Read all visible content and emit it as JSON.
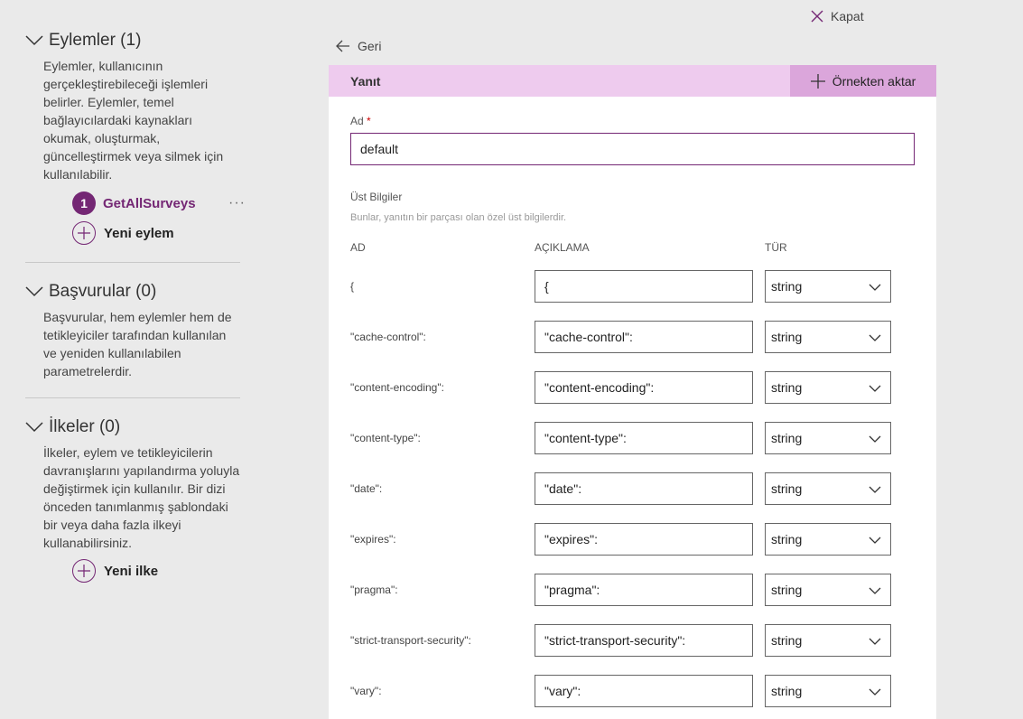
{
  "close": {
    "label": "Kapat",
    "icon": "close-icon"
  },
  "sidebar": {
    "actions": {
      "title": "Eylemler (1)",
      "description": "Eylemler, kullanıcının gerçekleştirebileceği işlemleri belirler. Eylemler, temel bağlayıcılardaki kaynakları okumak, oluşturmak, güncelleştirmek veya silmek için kullanılabilir.",
      "items": [
        {
          "number": "1",
          "name": "GetAllSurveys",
          "more": "···"
        }
      ],
      "new_label": "Yeni eylem"
    },
    "references": {
      "title": "Başvurular (0)",
      "description": "Başvurular, hem eylemler hem de tetikleyiciler tarafından kullanılan ve yeniden kullanılabilen parametrelerdir."
    },
    "policies": {
      "title": "İlkeler (0)",
      "description": "İlkeler, eylem ve tetikleyicilerin davranışlarını yapılandırma yoluyla değiştirmek için kullanılır. Bir dizi önceden tanımlanmış şablondaki bir veya daha fazla ilkeyi kullanabilirsiniz.",
      "new_label": "Yeni ilke"
    }
  },
  "back": {
    "label": "Geri"
  },
  "response": {
    "title": "Yanıt",
    "import_label": "Örnekten aktar",
    "name_label": "Ad",
    "required_mark": "*",
    "name_value": "default",
    "headers_title": "Üst Bilgiler",
    "headers_desc": "Bunlar, yanıtın bir parçası olan özel üst bilgilerdir.",
    "columns": {
      "name": "AD",
      "description": "AÇIKLAMA",
      "type": "TÜR"
    },
    "rows": [
      {
        "name": "{",
        "description": "{",
        "type": "string"
      },
      {
        "name": "\"cache-control\":",
        "description": "\"cache-control\":",
        "type": "string"
      },
      {
        "name": "\"content-encoding\":",
        "description": "\"content-encoding\":",
        "type": "string"
      },
      {
        "name": "\"content-type\":",
        "description": "\"content-type\":",
        "type": "string"
      },
      {
        "name": "\"date\":",
        "description": "\"date\":",
        "type": "string"
      },
      {
        "name": "\"expires\":",
        "description": "\"expires\":",
        "type": "string"
      },
      {
        "name": "\"pragma\":",
        "description": "\"pragma\":",
        "type": "string"
      },
      {
        "name": "\"strict-transport-security\":",
        "description": "\"strict-transport-security\":",
        "type": "string"
      },
      {
        "name": "\"vary\":",
        "description": "\"vary\":",
        "type": "string"
      }
    ]
  },
  "colors": {
    "accent": "#742774",
    "header_bg": "#eecbee",
    "import_bg": "#dba6db",
    "page_bg": "#eaeaea"
  }
}
